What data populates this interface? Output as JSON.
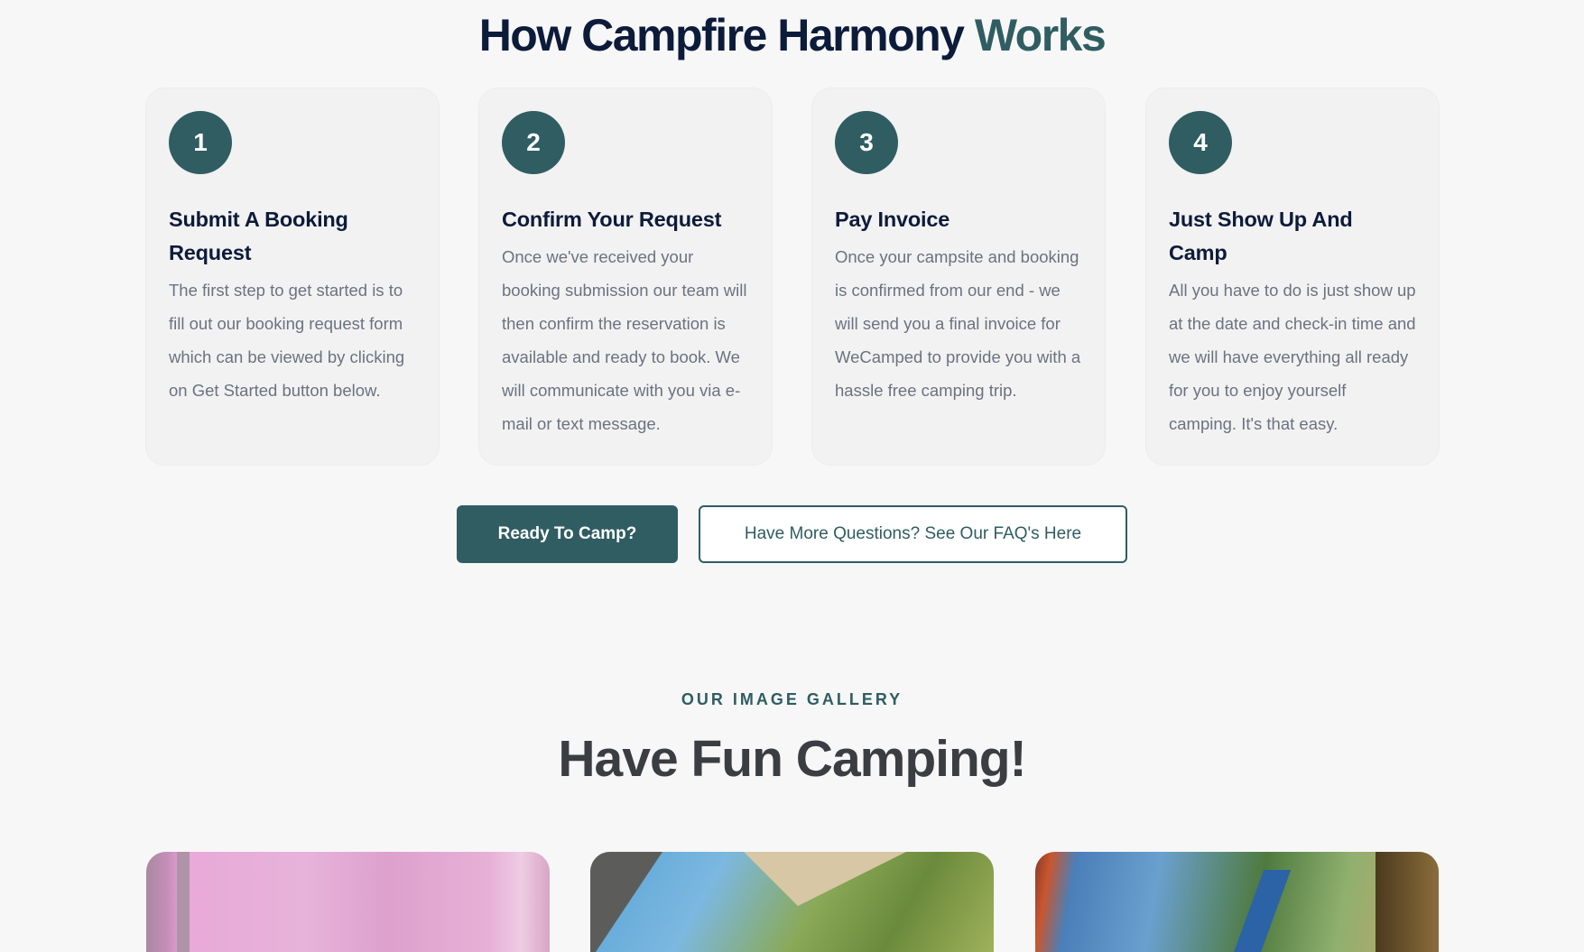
{
  "how_it_works": {
    "title_main": "How Campfire Harmony",
    "title_accent": "Works",
    "steps": [
      {
        "number": "1",
        "title": "Submit A Booking Request",
        "text": "The first step to get started is to fill out our booking request form which can be viewed by clicking on Get Started button below."
      },
      {
        "number": "2",
        "title": "Confirm Your Request",
        "text": "Once we've received your booking submission our team will then confirm the reservation is available and ready to book. We will communicate with you via e-mail or text message."
      },
      {
        "number": "3",
        "title": "Pay Invoice",
        "text": "Once your campsite and booking is confirmed from our end - we will send you a final invoice for WeCamped to provide you with a hassle free camping trip."
      },
      {
        "number": "4",
        "title": "Just Show Up And Camp",
        "text": "All you have to do is just show up at the date and check-in time and we will have everything all ready for you to enjoy yourself camping. It's that easy."
      }
    ],
    "primary_button": "Ready To Camp?",
    "secondary_button": "Have More Questions? See Our FAQ's Here"
  },
  "gallery": {
    "eyebrow": "OUR IMAGE GALLERY",
    "title": "Have Fun Camping!"
  },
  "colors": {
    "accent": "#2f5d62",
    "heading": "#0d1b3a",
    "body_text": "#6b7280",
    "background": "#f7f7f7"
  }
}
